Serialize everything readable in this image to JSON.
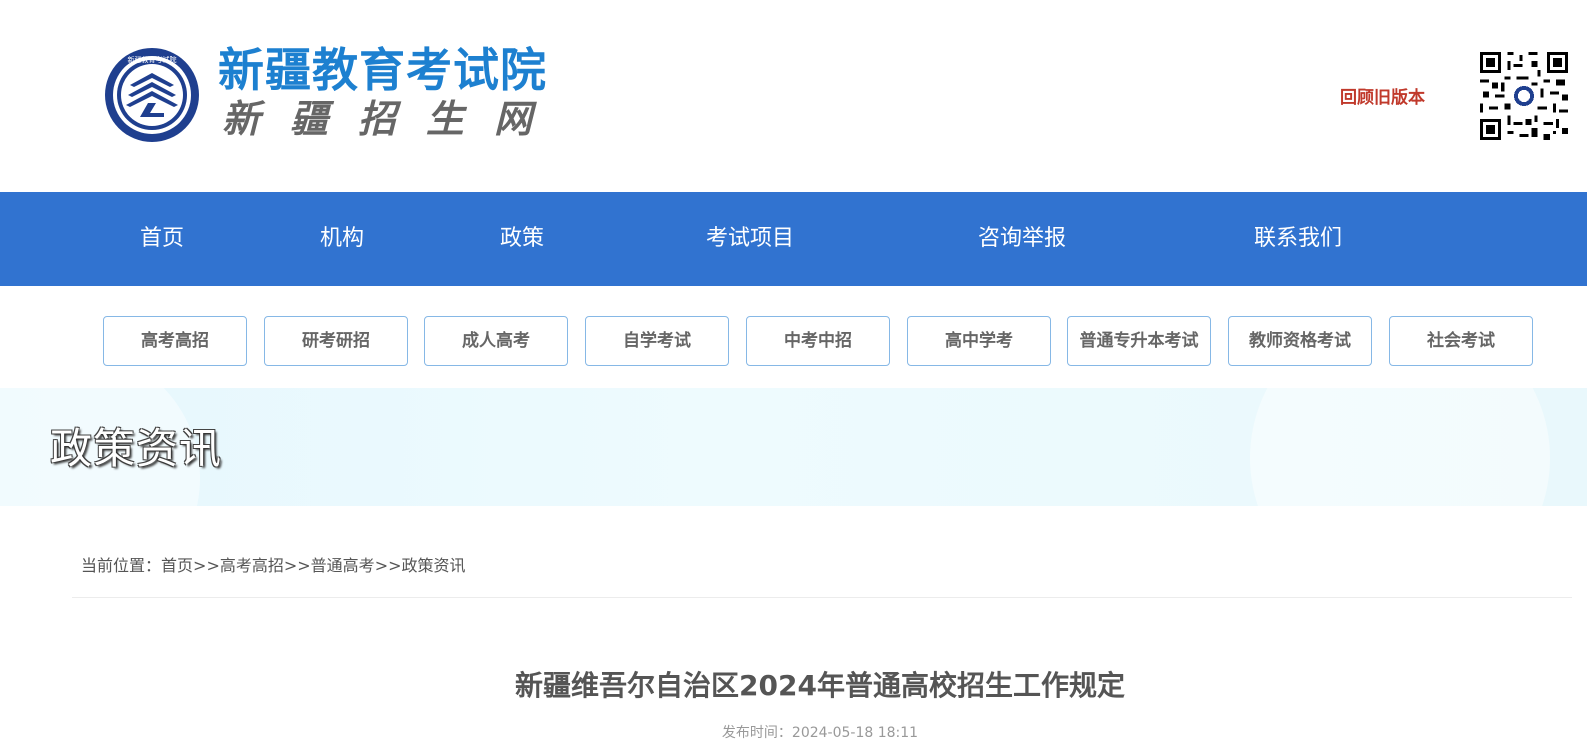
{
  "header": {
    "site_title": "新疆教育考试院",
    "site_subtitle": "新疆招生网",
    "emblem_text": "新疆教育考试院",
    "emblem_icon": "institute-emblem-icon",
    "old_version_label": "回顾旧版本",
    "qr_icon": "qr-code-icon",
    "brand_color": "#1d80d0",
    "link_color": "#c0392b"
  },
  "nav": {
    "color": "#3173d0",
    "items": [
      {
        "label": "首页"
      },
      {
        "label": "机构"
      },
      {
        "label": "政策"
      },
      {
        "label": "考试项目"
      },
      {
        "label": "咨询举报"
      },
      {
        "label": "联系我们"
      }
    ]
  },
  "categories": [
    {
      "label": "高考高招"
    },
    {
      "label": "研考研招"
    },
    {
      "label": "成人高考"
    },
    {
      "label": "自学考试"
    },
    {
      "label": "中考中招"
    },
    {
      "label": "高中学考"
    },
    {
      "label": "普通专升本考试"
    },
    {
      "label": "教师资格考试"
    },
    {
      "label": "社会考试"
    }
  ],
  "banner": {
    "title": "政策资讯"
  },
  "breadcrumb": {
    "prefix": "当前位置：",
    "items": [
      "首页",
      "高考高招",
      "普通高考",
      "政策资讯"
    ],
    "separator": ">>"
  },
  "article": {
    "title": "新疆维吾尔自治区2024年普通高校招生工作规定",
    "publish_label": "发布时间：",
    "publish_time": "2024-05-18 18:11"
  }
}
